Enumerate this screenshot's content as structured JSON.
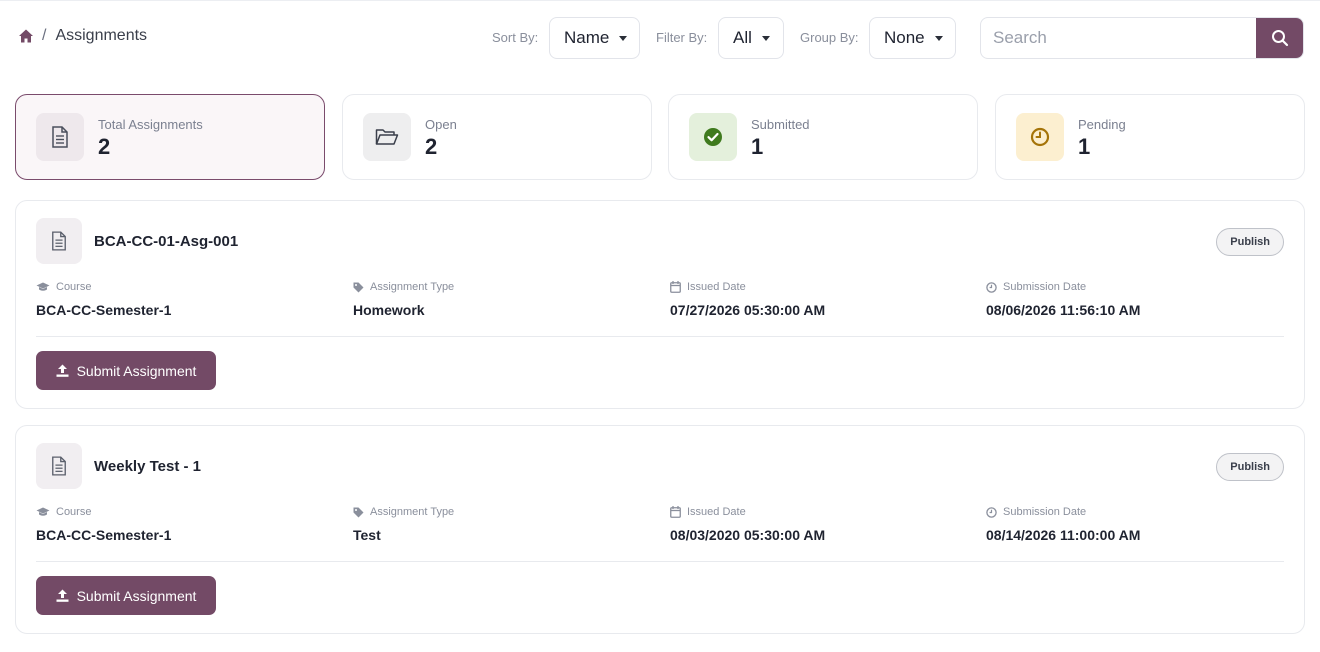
{
  "breadcrumb": {
    "separator": "/",
    "current": "Assignments"
  },
  "controls": {
    "sort_label": "Sort By:",
    "sort_value": "Name",
    "filter_label": "Filter By:",
    "filter_value": "All",
    "group_label": "Group By:",
    "group_value": "None",
    "search_placeholder": "Search"
  },
  "stats": [
    {
      "label": "Total Assignments",
      "value": "2",
      "icon": "document-icon"
    },
    {
      "label": "Open",
      "value": "2",
      "icon": "folder-open-icon"
    },
    {
      "label": "Submitted",
      "value": "1",
      "icon": "check-circle-icon"
    },
    {
      "label": "Pending",
      "value": "1",
      "icon": "clock-icon"
    }
  ],
  "field_labels": {
    "course": "Course",
    "type": "Assignment Type",
    "issued": "Issued Date",
    "submission": "Submission Date"
  },
  "assignments": [
    {
      "title": "BCA-CC-01-Asg-001",
      "status": "Publish",
      "course": "BCA-CC-Semester-1",
      "type": "Homework",
      "issued": "07/27/2026 05:30:00 AM",
      "submission": "08/06/2026 11:56:10 AM",
      "action_label": "Submit Assignment"
    },
    {
      "title": "Weekly Test - 1",
      "status": "Publish",
      "course": "BCA-CC-Semester-1",
      "type": "Test",
      "issued": "08/03/2020 05:30:00 AM",
      "submission": "08/14/2026 11:00:00 AM",
      "action_label": "Submit Assignment"
    }
  ],
  "colors": {
    "accent": "#734a66",
    "submitted_bg": "#e4f0dc",
    "submitted_fg": "#3f7a1e",
    "pending_bg": "#fcefd0",
    "pending_fg": "#a57409"
  }
}
